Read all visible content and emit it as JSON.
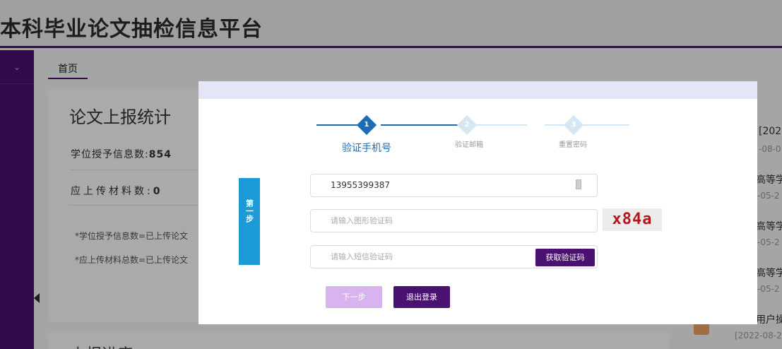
{
  "header": {
    "title": "本科毕业论文抽检信息平台"
  },
  "sidebar": {
    "toggle_icon": "chevron-down-icon",
    "toggle_glyph": "⌄"
  },
  "breadcrumb": {
    "home": "首页"
  },
  "stats": {
    "title": "论文上报统计",
    "degree_label": "学位授予信息数:",
    "degree_value": "854",
    "upload_label": "应上传材料数:",
    "upload_value": "0",
    "note1": "*学位授予信息数=已上传论文",
    "note2": "*应上传材料总数=已上传论文"
  },
  "progress_section": {
    "title": "上报进度"
  },
  "news": [
    {
      "title": "",
      "date": "[202"
    },
    {
      "title": "",
      "date": "-08-0"
    },
    {
      "title": "高等学",
      "date": "-05-2"
    },
    {
      "title": "高等学",
      "date": "-05-2"
    },
    {
      "title": "高等学",
      "date": "-05-2"
    },
    {
      "title": "用户操",
      "date": "[2022-08-2"
    }
  ],
  "modal": {
    "steps": [
      {
        "num": "1",
        "label": "验证手机号"
      },
      {
        "num": "2",
        "label": "验证邮箱"
      },
      {
        "num": "3",
        "label": "重置密码"
      }
    ],
    "side_tag": "第一步",
    "phone_value": "13955399387",
    "captcha_placeholder": "请输入图形验证码",
    "captcha_text": "x84a",
    "sms_placeholder": "请输入短信验证码",
    "sms_button": "获取验证码",
    "next_button": "下一步",
    "logout_button": "退出登录"
  },
  "colors": {
    "brand": "#4b1170",
    "step_active": "#1b6eb5",
    "step_inactive": "#d6e6f2",
    "side_tag": "#1b9ad6"
  }
}
